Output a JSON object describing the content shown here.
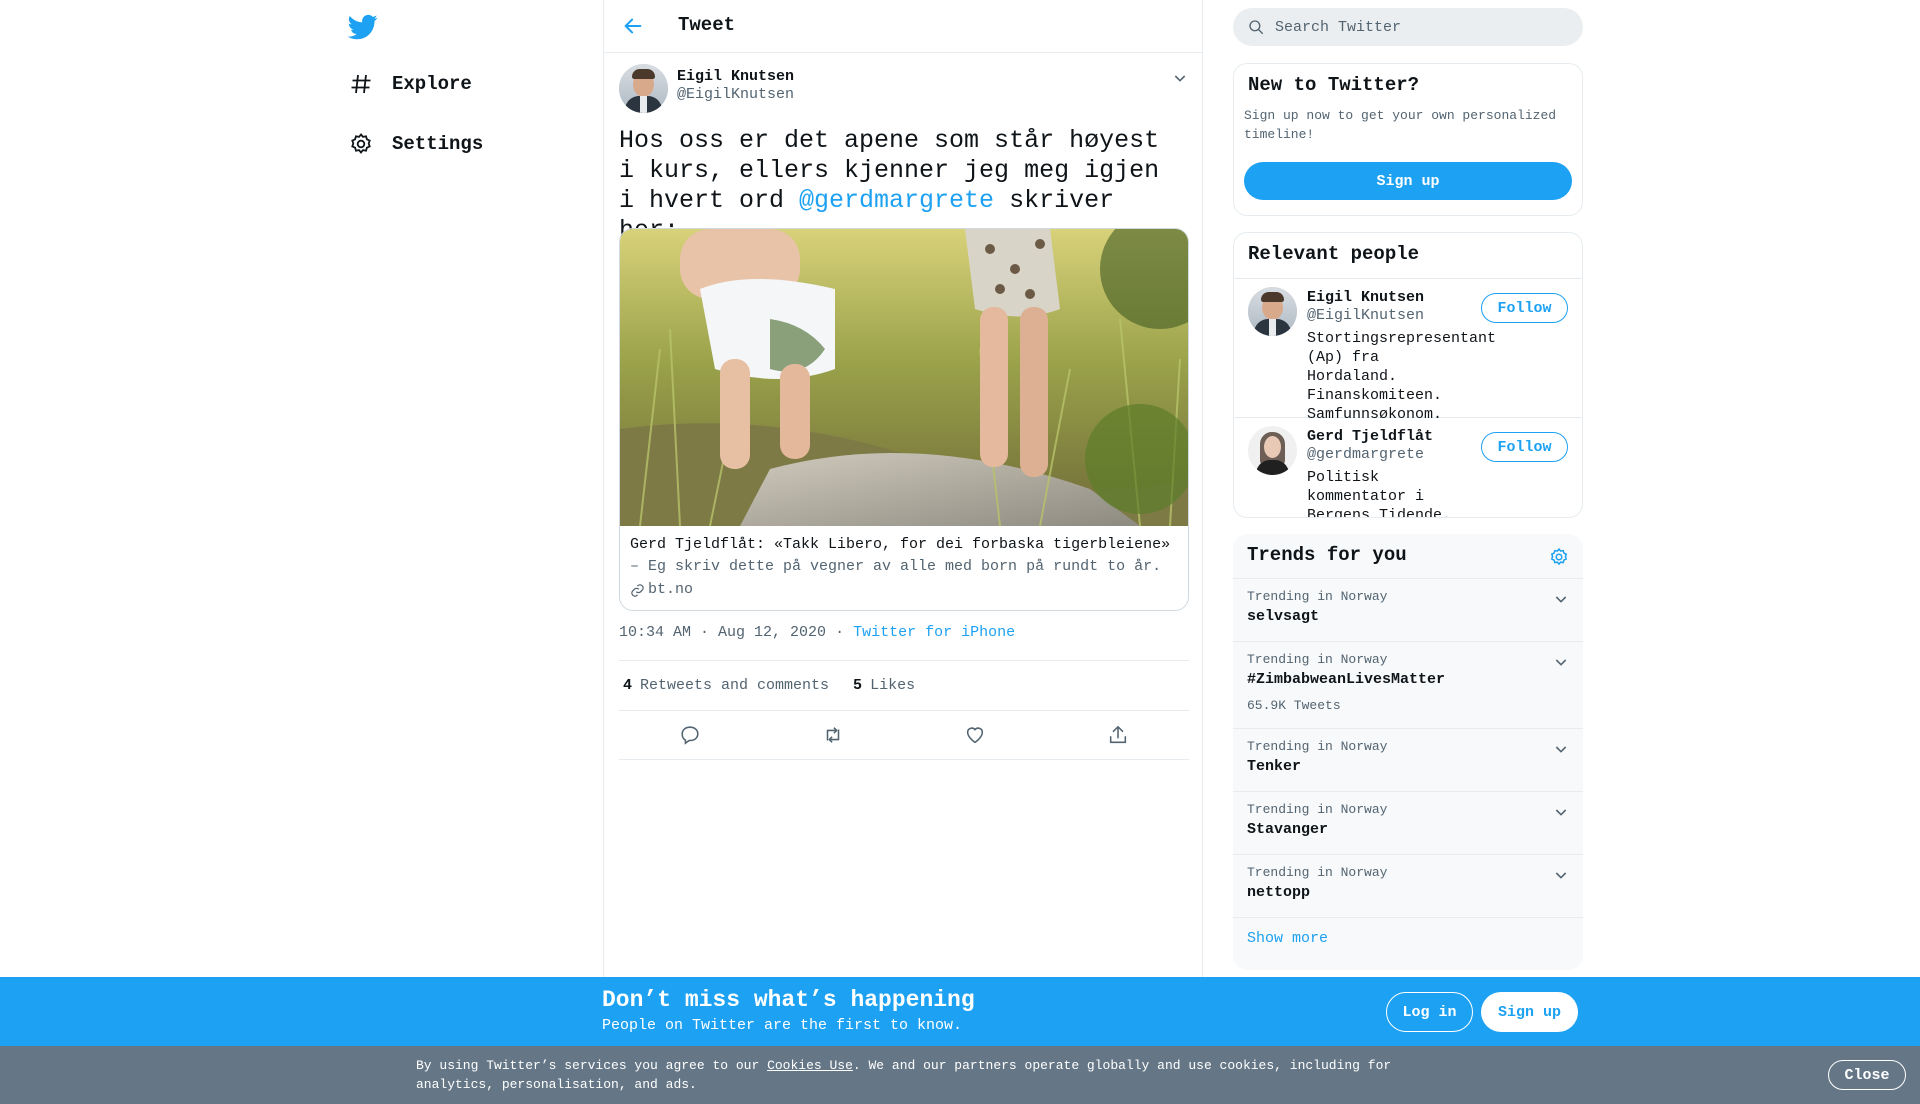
{
  "nav": {
    "items": [
      {
        "label": "Explore",
        "icon": "hashtag-icon"
      },
      {
        "label": "Settings",
        "icon": "gear-icon"
      }
    ]
  },
  "header": {
    "title": "Tweet"
  },
  "tweet": {
    "author_name": "Eigil Knutsen",
    "author_handle": "@EigilKnutsen",
    "text_before": "Hos oss er det apene som står høyest i kurs, ellers kjenner jeg meg igjen i hvert ord ",
    "mention": "@gerdmargrete",
    "text_after": " skriver her:",
    "card": {
      "title": "Gerd Tjeldflåt: «Takk Libero, for dei forbaska tigerbleiene»",
      "description": "– Eg skriv dette på vegner av alle med born på rundt to år.",
      "domain": "bt.no"
    },
    "time": "10:34 AM · Aug 12, 2020",
    "separator": "·",
    "source": "Twitter for iPhone",
    "retweets_count": "4",
    "retweets_label": "Retweets and comments",
    "likes_count": "5",
    "likes_label": "Likes"
  },
  "search": {
    "placeholder": "Search Twitter"
  },
  "new_to_twitter": {
    "title": "New to Twitter?",
    "subtitle": "Sign up now to get your own personalized timeline!",
    "button": "Sign up"
  },
  "relevant_people": {
    "title": "Relevant people",
    "people": [
      {
        "name": "Eigil Knutsen",
        "handle": "@EigilKnutsen",
        "bio": "Stortingsrepresentant (Ap) fra Hordaland. Finanskomiteen. Samfunnsøkonom.",
        "button": "Follow"
      },
      {
        "name": "Gerd Tjeldflåt",
        "handle": "@gerdmargrete",
        "bio": "Politisk kommentator i Bergens Tidende.",
        "button": "Follow"
      }
    ]
  },
  "trends": {
    "title": "Trends for you",
    "items": [
      {
        "context": "Trending in Norway",
        "name": "selvsagt",
        "count": ""
      },
      {
        "context": "Trending in Norway",
        "name": "#ZimbabweanLivesMatter",
        "count": "65.9K Tweets"
      },
      {
        "context": "Trending in Norway",
        "name": "Tenker",
        "count": ""
      },
      {
        "context": "Trending in Norway",
        "name": "Stavanger",
        "count": ""
      },
      {
        "context": "Trending in Norway",
        "name": "nettopp",
        "count": ""
      }
    ],
    "show_more": "Show more"
  },
  "banner": {
    "title": "Don’t miss what’s happening",
    "subtitle": "People on Twitter are the first to know.",
    "login": "Log in",
    "signup": "Sign up"
  },
  "cookie": {
    "text_before": "By using Twitter’s services you agree to our ",
    "link": "Cookies Use",
    "text_after": ". We and our partners operate globally and use cookies, including for analytics, personalisation, and ads.",
    "close": "Close"
  },
  "colors": {
    "accent": "#1da1f2",
    "secondary_text": "#536471",
    "border": "#e6ecf0",
    "cookie_bar": "#657786"
  }
}
